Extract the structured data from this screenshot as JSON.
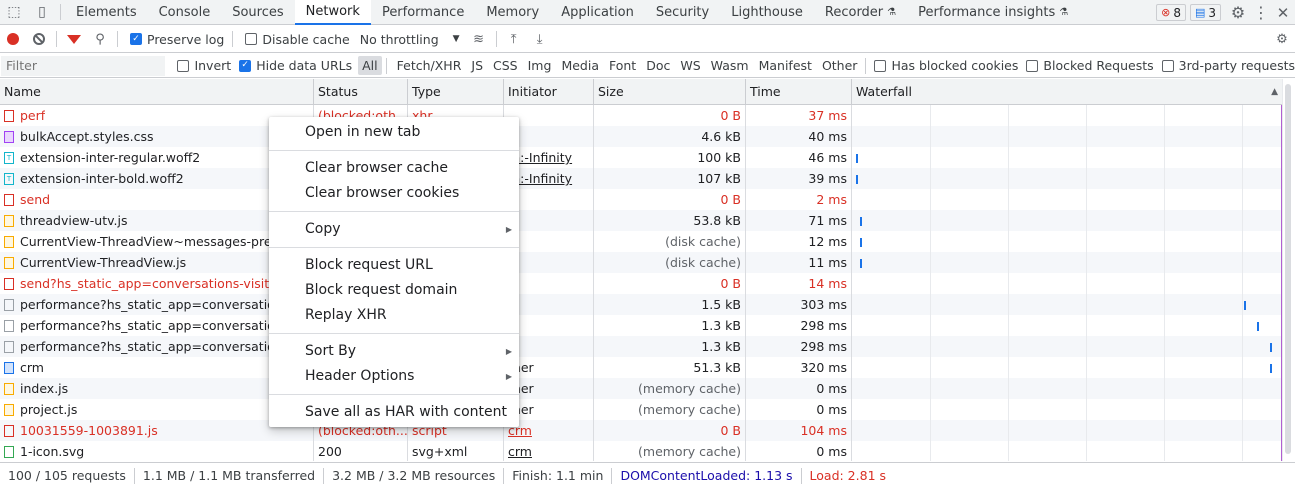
{
  "tabs": [
    "Elements",
    "Console",
    "Sources",
    "Network",
    "Performance",
    "Memory",
    "Application",
    "Security",
    "Lighthouse",
    "Recorder",
    "Performance insights"
  ],
  "active_tab": "Network",
  "badges": {
    "errors": "8",
    "messages": "3"
  },
  "toolbar": {
    "preserve_log": "Preserve log",
    "disable_cache": "Disable cache",
    "throttling": "No throttling"
  },
  "filter": {
    "placeholder": "Filter",
    "invert": "Invert",
    "hide_data_urls": "Hide data URLs",
    "types": [
      "All",
      "Fetch/XHR",
      "JS",
      "CSS",
      "Img",
      "Media",
      "Font",
      "Doc",
      "WS",
      "Wasm",
      "Manifest",
      "Other"
    ],
    "has_blocked_cookies": "Has blocked cookies",
    "blocked_requests": "Blocked Requests",
    "third_party": "3rd-party requests"
  },
  "columns": [
    "Name",
    "Status",
    "Type",
    "Initiator",
    "Size",
    "Time",
    "Waterfall"
  ],
  "rows": [
    {
      "name": "perf",
      "status": "(blocked:oth...",
      "type": "xhr",
      "initiator": "",
      "size": "0 B",
      "time": "37 ms",
      "red": true,
      "icon": "red",
      "wf": null
    },
    {
      "name": "bulkAccept.styles.css",
      "status": "",
      "type": "",
      "initiator": "",
      "size": "4.6 kB",
      "time": "40 ms",
      "red": false,
      "icon": "css",
      "wf": null
    },
    {
      "name": "extension-inter-regular.woff2",
      "status": "",
      "type": "",
      "initiator": "m:-Infinity",
      "size": "100 kB",
      "time": "46 ms",
      "red": false,
      "icon": "font",
      "wf": 0.01
    },
    {
      "name": "extension-inter-bold.woff2",
      "status": "",
      "type": "",
      "initiator": "m:-Infinity",
      "size": "107 kB",
      "time": "39 ms",
      "red": false,
      "icon": "font",
      "wf": 0.01
    },
    {
      "name": "send",
      "status": "",
      "type": "",
      "initiator": "",
      "size": "0 B",
      "time": "2 ms",
      "red": true,
      "icon": "red",
      "wf": null
    },
    {
      "name": "threadview-utv.js",
      "status": "",
      "type": "",
      "initiator": "",
      "size": "53.8 kB",
      "time": "71 ms",
      "red": false,
      "icon": "js",
      "wf": 0.02
    },
    {
      "name": "CurrentView-ThreadView~messages-preview",
      "status": "",
      "type": "",
      "initiator": "",
      "size": "(disk cache)",
      "time": "12 ms",
      "red": false,
      "icon": "js",
      "wf": 0.02
    },
    {
      "name": "CurrentView-ThreadView.js",
      "status": "",
      "type": "",
      "initiator": "",
      "size": "(disk cache)",
      "time": "11 ms",
      "red": false,
      "icon": "js",
      "wf": 0.02
    },
    {
      "name": "send?hs_static_app=conversations-visitor-ui",
      "status": "",
      "type": "",
      "initiator": "",
      "size": "0 B",
      "time": "14 ms",
      "red": true,
      "icon": "red",
      "wf": null
    },
    {
      "name": "performance?hs_static_app=conversations-visitor-ui",
      "status": "",
      "type": "",
      "initiator": "",
      "size": "1.5 kB",
      "time": "303 ms",
      "red": false,
      "icon": "plain",
      "wf": 0.93
    },
    {
      "name": "performance?hs_static_app=conversations-visitor-ui",
      "status": "",
      "type": "",
      "initiator": "",
      "size": "1.3 kB",
      "time": "298 ms",
      "red": false,
      "icon": "plain",
      "wf": 0.96
    },
    {
      "name": "performance?hs_static_app=conversations-visitor-ui",
      "status": "",
      "type": "",
      "initiator": "",
      "size": "1.3 kB",
      "time": "298 ms",
      "red": false,
      "icon": "plain",
      "wf": 0.99
    },
    {
      "name": "crm",
      "status": "",
      "type": "",
      "initiator": "ther",
      "size": "51.3 kB",
      "time": "320 ms",
      "red": false,
      "icon": "doc",
      "wf": 0.99
    },
    {
      "name": "index.js",
      "status": "",
      "type": "",
      "initiator": "ther",
      "size": "(memory cache)",
      "time": "0 ms",
      "red": false,
      "icon": "js",
      "wf": null
    },
    {
      "name": "project.js",
      "status": "",
      "type": "",
      "initiator": "ther",
      "size": "(memory cache)",
      "time": "0 ms",
      "red": false,
      "icon": "js",
      "wf": null
    },
    {
      "name": "10031559-1003891.js",
      "status": "(blocked:oth...",
      "type": "script",
      "initiator": "crm",
      "size": "0 B",
      "time": "104 ms",
      "red": true,
      "icon": "red",
      "wf": null
    },
    {
      "name": "1-icon.svg",
      "status": "200",
      "type": "svg+xml",
      "initiator": "crm",
      "size": "(memory cache)",
      "time": "0 ms",
      "red": false,
      "icon": "img",
      "wf": null
    }
  ],
  "context_menu": {
    "groups": [
      [
        {
          "label": "Open in new tab",
          "submenu": false
        }
      ],
      [
        {
          "label": "Clear browser cache",
          "submenu": false
        },
        {
          "label": "Clear browser cookies",
          "submenu": false
        }
      ],
      [
        {
          "label": "Copy",
          "submenu": true
        }
      ],
      [
        {
          "label": "Block request URL",
          "submenu": false
        },
        {
          "label": "Block request domain",
          "submenu": false
        },
        {
          "label": "Replay XHR",
          "submenu": false
        }
      ],
      [
        {
          "label": "Sort By",
          "submenu": true
        },
        {
          "label": "Header Options",
          "submenu": true
        }
      ],
      [
        {
          "label": "Save all as HAR with content",
          "submenu": false
        }
      ]
    ]
  },
  "status_bar": {
    "requests": "100 / 105 requests",
    "transferred": "1.1 MB / 1.1 MB transferred",
    "resources": "3.2 MB / 3.2 MB resources",
    "finish": "Finish: 1.1 min",
    "dom_content_loaded": "DOMContentLoaded: 1.13 s",
    "load": "Load: 2.81 s"
  },
  "colors": {
    "accent": "#1a73e8",
    "error": "#d93025",
    "load_line": "#b15ed1"
  }
}
